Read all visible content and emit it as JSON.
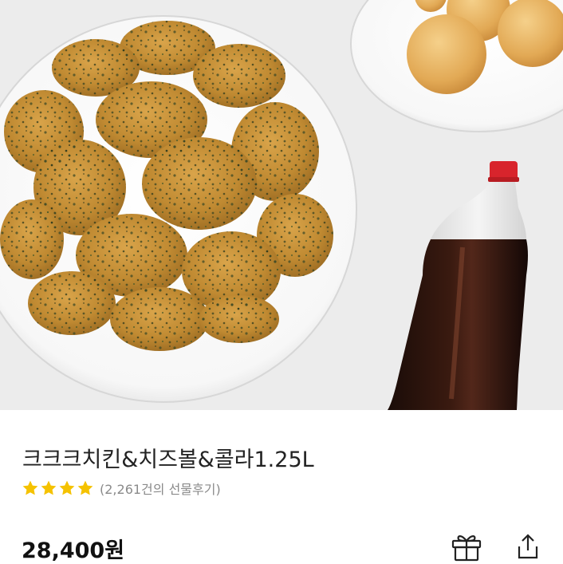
{
  "product": {
    "name": "크크크치킨&치즈볼&콜라1.25L",
    "rating": 4,
    "rating_max": 4,
    "review_text": "(2,261건의 선물후기)",
    "price": "28,400원"
  },
  "icons": {
    "star": "star-icon",
    "gift": "gift-icon",
    "share": "share-icon"
  },
  "colors": {
    "star": "#f5c200",
    "text": "#222222",
    "muted": "#8a8a8a",
    "cola_cap": "#d8242c"
  }
}
